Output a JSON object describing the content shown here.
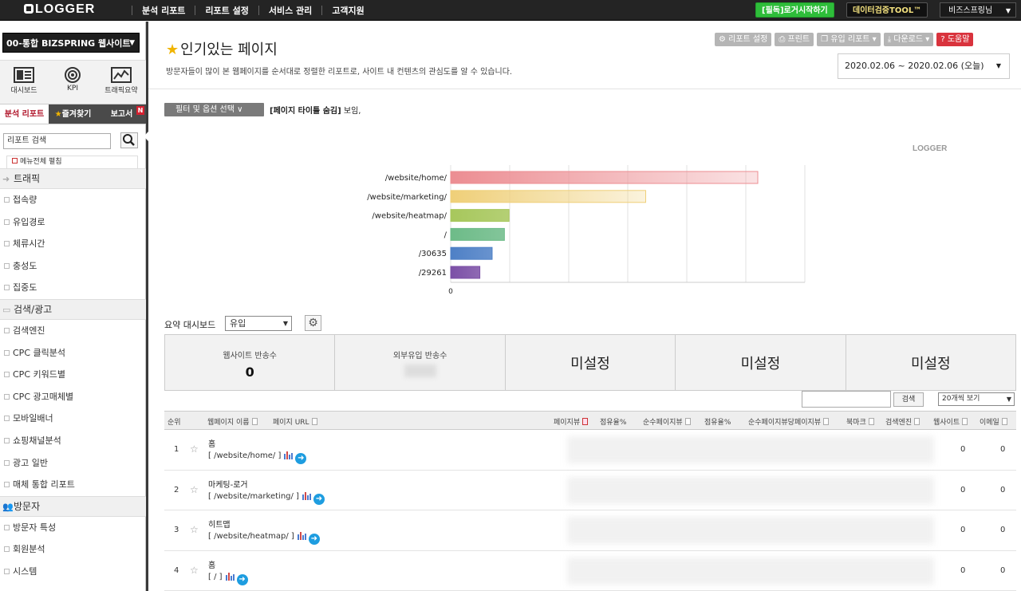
{
  "topbar": {
    "logo": "LOGGER",
    "nav": [
      "분석 리포트",
      "리포트 설정",
      "서비스 관리",
      "고객지원"
    ],
    "btn_start": "[필독]로거시작하기",
    "btn_tool": "데이터검증TOOL™",
    "user": "비즈스프링님"
  },
  "sidebar": {
    "site": "00-통합 BIZSPRING 웹사이트",
    "icons": [
      {
        "label": "대시보드",
        "icon": "dashboard-icon"
      },
      {
        "label": "KPI",
        "icon": "target-icon"
      },
      {
        "label": "트래픽요약",
        "icon": "chart-line-icon"
      }
    ],
    "tabs": [
      "분석 리포트",
      "즐겨찾기",
      "보고서"
    ],
    "tab_badge": "N",
    "search_value": "리포트 검색",
    "expand_all": "메뉴전체 펼침",
    "sections": [
      {
        "title": "트래픽",
        "items": [
          "접속량",
          "유입경로",
          "체류시간",
          "충성도",
          "집중도"
        ]
      },
      {
        "title": "검색/광고",
        "items": [
          "검색엔진",
          "CPC 클릭분석",
          "CPC 키워드별",
          "CPC 광고매체별",
          "모바일배너",
          "쇼핑채널분석",
          "광고 일반",
          "매체 통합 리포트"
        ]
      },
      {
        "title": "방문자",
        "items": [
          "방문자 특성",
          "회원분석",
          "시스템"
        ]
      }
    ]
  },
  "page": {
    "title": "인기있는 페이지",
    "description": "방문자들이 많이 본 웹페이지를 순서대로 정렬한 리포트로, 사이트 내 컨텐츠의 관심도를 알 수 있습니다.",
    "tools": [
      "리포트 설정",
      "프린트",
      "유입 리포트",
      "다운로드",
      "도움말"
    ],
    "date_range": "2020.02.06 ~ 2020.02.06 (오늘)",
    "filter_btn": "필터 및 옵션 선택",
    "filter_note_bold": "[페이지 타이틀 숨김]",
    "filter_note": " 보임,"
  },
  "chart_data": {
    "type": "bar",
    "orientation": "horizontal",
    "categories": [
      "/website/home/",
      "/website/marketing/",
      "/website/heatmap/",
      "/",
      "/30635",
      "/29261"
    ],
    "values": [
      100,
      63.5,
      19,
      17.5,
      13.5,
      9.5
    ],
    "colors": [
      "#ec8d92",
      "#efcf78",
      "#a7c75c",
      "#6dbb88",
      "#4e80c6",
      "#7b4fa6"
    ],
    "x_tick_first": "0",
    "watermark": "LOGGER"
  },
  "summary": {
    "label": "요약 대시보드",
    "select_value": "유입",
    "cards": [
      {
        "label": "웹사이트 반송수",
        "value": "0"
      },
      {
        "label": "외부유입 반송수",
        "value": ""
      },
      {
        "big": "미설정"
      },
      {
        "big": "미설정"
      },
      {
        "big": "미설정"
      }
    ]
  },
  "table": {
    "search_btn": "검색",
    "per_page": "20개씩 보기",
    "headers": [
      "순위",
      "웹페이지 이름",
      "페이지 URL",
      "페이지뷰",
      "점유율%",
      "순수페이지뷰",
      "점유율%",
      "순수페이지뷰당페이지뷰",
      "북마크",
      "검색엔진",
      "웹사이트",
      "이메일"
    ],
    "rows": [
      {
        "rank": "1",
        "name": "홈",
        "url": "[ /website/home/ ]",
        "web": "0",
        "email": "0"
      },
      {
        "rank": "2",
        "name": "마케팅-로거",
        "url": "[ /website/marketing/ ]",
        "web": "0",
        "email": "0"
      },
      {
        "rank": "3",
        "name": "히트맵",
        "url": "[ /website/heatmap/ ]",
        "web": "0",
        "email": "0"
      },
      {
        "rank": "4",
        "name": "홈",
        "url": "[ / ]",
        "web": "0",
        "email": "0"
      }
    ]
  }
}
